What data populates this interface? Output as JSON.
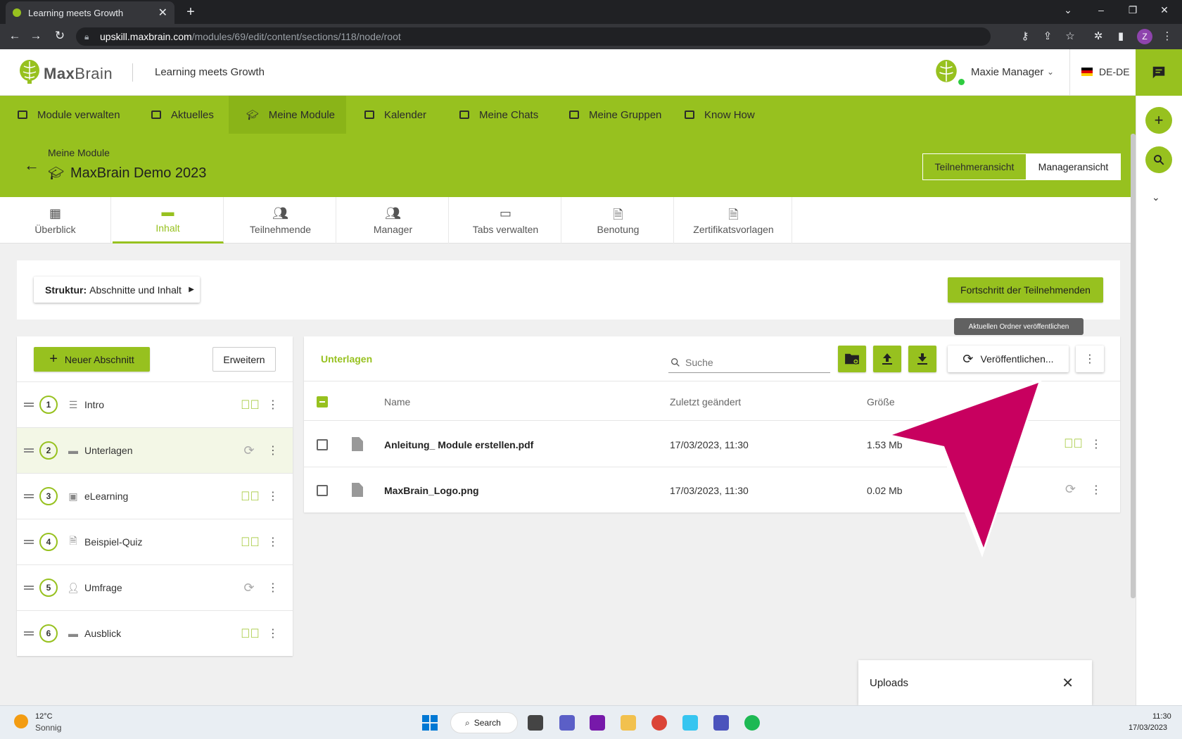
{
  "browser": {
    "tab_title": "Learning meets Growth",
    "url_host": "upskill.maxbrain.com",
    "url_path": "/modules/69/edit/content/sections/118/node/root",
    "profile_initial": "Z"
  },
  "header": {
    "logo_max": "Max",
    "logo_brain": "Brain",
    "tagline": "Learning meets Growth",
    "user_name": "Maxie Manager",
    "language": "DE-DE"
  },
  "nav": [
    {
      "label": "Module verwalten",
      "icon": "folder-icon"
    },
    {
      "label": "Aktuelles",
      "icon": "news-icon"
    },
    {
      "label": "Meine Module",
      "icon": "graduation-cap-icon"
    },
    {
      "label": "Kalender",
      "icon": "calendar-icon"
    },
    {
      "label": "Meine Chats",
      "icon": "chat-icon"
    },
    {
      "label": "Meine Gruppen",
      "icon": "group-icon"
    },
    {
      "label": "Know How",
      "icon": "book-icon"
    }
  ],
  "module": {
    "breadcrumb": "Meine Module",
    "title": "MaxBrain Demo 2023",
    "view_participant": "Teilnehmeransicht",
    "view_manager": "Manageransicht"
  },
  "tabs": [
    {
      "label": "Überblick",
      "icon": "dashboard-icon"
    },
    {
      "label": "Inhalt",
      "icon": "folder-icon"
    },
    {
      "label": "Teilnehmende",
      "icon": "people-icon"
    },
    {
      "label": "Manager",
      "icon": "manager-icon"
    },
    {
      "label": "Tabs verwalten",
      "icon": "window-icon"
    },
    {
      "label": "Benotung",
      "icon": "grade-icon"
    },
    {
      "label": "Zertifikatsvorlagen",
      "icon": "certificate-icon"
    }
  ],
  "structure": {
    "label_bold": "Struktur:",
    "label": "Abschnitte und Inhalt",
    "progress_button": "Fortschritt der Teilnehmenden",
    "tooltip": "Aktuellen Ordner veröffentlichen"
  },
  "sections": {
    "new_button": "Neuer Abschnitt",
    "expand_button": "Erweitern",
    "items": [
      {
        "num": "1",
        "label": "Intro",
        "icon": "text-icon",
        "status": "published"
      },
      {
        "num": "2",
        "label": "Unterlagen",
        "icon": "folder-icon",
        "status": "sync"
      },
      {
        "num": "3",
        "label": "eLearning",
        "icon": "monitor-icon",
        "status": "published"
      },
      {
        "num": "4",
        "label": "Beispiel-Quiz",
        "icon": "quiz-icon",
        "status": "published"
      },
      {
        "num": "5",
        "label": "Umfrage",
        "icon": "survey-icon",
        "status": "sync"
      },
      {
        "num": "6",
        "label": "Ausblick",
        "icon": "folder-icon",
        "status": "published"
      }
    ]
  },
  "files": {
    "folder_title": "Unterlagen",
    "search_placeholder": "Suche",
    "publish_button": "Veröffentlichen...",
    "columns": {
      "name": "Name",
      "modified": "Zuletzt geändert",
      "size": "Größe"
    },
    "rows": [
      {
        "name": "Anleitung_ Module erstellen.pdf",
        "modified": "17/03/2023, 11:30",
        "size": "1.53 Mb",
        "status": "published"
      },
      {
        "name": "MaxBrain_Logo.png",
        "modified": "17/03/2023, 11:30",
        "size": "0.02 Mb",
        "status": "sync"
      }
    ]
  },
  "uploads": {
    "label": "Uploads"
  },
  "taskbar": {
    "temp": "12°C",
    "weather": "Sonnig",
    "search": "Search",
    "time": "11:30",
    "date": "17/03/2023"
  },
  "colors": {
    "accent": "#97c11f",
    "arrow": "#c8005f"
  }
}
